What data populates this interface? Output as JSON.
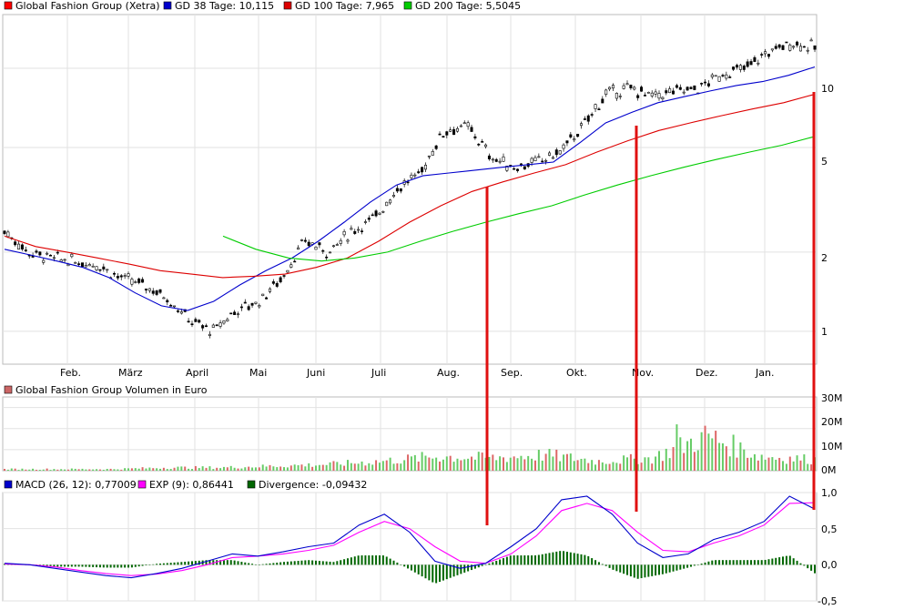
{
  "chart_data": [
    {
      "type": "line",
      "panel": "price",
      "scale": "log",
      "ylim": [
        0.75,
        16
      ],
      "y_ticks": [
        1,
        2,
        5,
        10
      ],
      "x_tick_labels": [
        "Feb.",
        "März",
        "April",
        "Mai",
        "Juni",
        "Juli",
        "Aug.",
        "Sep.",
        "Okt.",
        "Nov.",
        "Dez.",
        "Jan."
      ],
      "grid": true,
      "legend": [
        {
          "label": "Global Fashion Group (Xetra)",
          "color": "#ff0000"
        },
        {
          "label": "GD 38 Tage: 10,115",
          "color": "#0000cc"
        },
        {
          "label": "GD 100 Tage: 7,965",
          "color": "#dd0000"
        },
        {
          "label": "GD 200 Tage: 5,5045",
          "color": "#00cc00"
        }
      ],
      "price_points": [
        {
          "date": "Jan",
          "v": 2.4
        },
        {
          "date": "Jan",
          "v": 2.0
        },
        {
          "date": "Feb",
          "v": 1.9
        },
        {
          "date": "Feb",
          "v": 1.85
        },
        {
          "date": "Mär",
          "v": 1.8
        },
        {
          "date": "Mär",
          "v": 1.6
        },
        {
          "date": "Mär",
          "v": 1.5
        },
        {
          "date": "Mär",
          "v": 1.35
        },
        {
          "date": "Apr",
          "v": 1.1
        },
        {
          "date": "Apr",
          "v": 1.0
        },
        {
          "date": "Apr",
          "v": 1.2
        },
        {
          "date": "Apr",
          "v": 1.3
        },
        {
          "date": "Mai",
          "v": 1.6
        },
        {
          "date": "Mai",
          "v": 2.2
        },
        {
          "date": "Jun",
          "v": 2.0
        },
        {
          "date": "Jun",
          "v": 2.4
        },
        {
          "date": "Jul",
          "v": 2.7
        },
        {
          "date": "Jul",
          "v": 3.5
        },
        {
          "date": "Aug",
          "v": 4.0
        },
        {
          "date": "Aug",
          "v": 5.8
        },
        {
          "date": "Aug",
          "v": 6.0
        },
        {
          "date": "Sep",
          "v": 4.6
        },
        {
          "date": "Sep",
          "v": 4.2
        },
        {
          "date": "Sep",
          "v": 4.4
        },
        {
          "date": "Okt",
          "v": 4.8
        },
        {
          "date": "Okt",
          "v": 6.0
        },
        {
          "date": "Okt",
          "v": 8.0
        },
        {
          "date": "Nov",
          "v": 8.4
        },
        {
          "date": "Nov",
          "v": 7.8
        },
        {
          "date": "Nov",
          "v": 8.2
        },
        {
          "date": "Dez",
          "v": 8.4
        },
        {
          "date": "Dez",
          "v": 9.5
        },
        {
          "date": "Dez",
          "v": 10.0
        },
        {
          "date": "Jan",
          "v": 11.5
        },
        {
          "date": "Jan",
          "v": 12.5
        },
        {
          "date": "Jan",
          "v": 12.0
        }
      ],
      "series": [
        {
          "name": "GD 38 Tage",
          "color": "#0000cc",
          "values": [
            2.05,
            1.95,
            1.85,
            1.75,
            1.6,
            1.4,
            1.25,
            1.2,
            1.3,
            1.5,
            1.7,
            1.9,
            2.2,
            2.6,
            3.1,
            3.6,
            3.9,
            4.0,
            4.1,
            4.2,
            4.3,
            4.4,
            5.2,
            6.2,
            6.8,
            7.4,
            7.8,
            8.2,
            8.6,
            8.9,
            9.4,
            10.115
          ]
        },
        {
          "name": "GD 100 Tage",
          "color": "#dd0000",
          "values": [
            2.3,
            2.1,
            2.0,
            1.9,
            1.8,
            1.7,
            1.65,
            1.6,
            1.62,
            1.65,
            1.75,
            1.9,
            2.2,
            2.6,
            3.0,
            3.4,
            3.7,
            4.0,
            4.3,
            4.8,
            5.3,
            5.8,
            6.2,
            6.6,
            7.0,
            7.4,
            7.965
          ]
        },
        {
          "name": "GD 200 Tage",
          "color": "#00cc00",
          "values": [
            2.3,
            2.05,
            1.9,
            1.85,
            1.9,
            2.0,
            2.2,
            2.4,
            2.6,
            2.8,
            3.0,
            3.3,
            3.6,
            3.9,
            4.2,
            4.5,
            4.8,
            5.1,
            5.5045
          ]
        }
      ]
    },
    {
      "type": "bar",
      "panel": "volume",
      "title": "Global Fashion Group Volumen in Euro",
      "y_ticks": [
        "0M",
        "10M",
        "20M",
        "30M"
      ],
      "ylim": [
        0,
        35
      ],
      "peak_values_M": [
        1,
        1,
        1,
        2,
        2,
        3,
        4,
        6,
        9,
        8,
        10,
        6,
        8,
        22,
        9,
        7
      ]
    },
    {
      "type": "line",
      "panel": "macd",
      "ylim": [
        -0.5,
        1.0
      ],
      "y_ticks": [
        "1,0",
        "0,5",
        "0,0",
        "-0,5"
      ],
      "legend": [
        {
          "label": "MACD (26, 12): 0,77009",
          "color": "#0000cc"
        },
        {
          "label": "EXP (9): 0,86441",
          "color": "#ff00ff"
        },
        {
          "label": "Divergence: -0,09432",
          "color": "#006600"
        }
      ],
      "series": [
        {
          "name": "MACD (26, 12)",
          "color": "#0000cc",
          "values": [
            0.02,
            0.0,
            -0.05,
            -0.1,
            -0.15,
            -0.18,
            -0.12,
            -0.05,
            0.05,
            0.15,
            0.12,
            0.18,
            0.25,
            0.3,
            0.55,
            0.7,
            0.45,
            0.05,
            -0.05,
            0.02,
            0.25,
            0.5,
            0.9,
            0.95,
            0.7,
            0.3,
            0.1,
            0.15,
            0.35,
            0.45,
            0.6,
            0.95,
            0.77
          ]
        },
        {
          "name": "EXP (9)",
          "color": "#ff00ff",
          "values": [
            0.01,
            0.0,
            -0.03,
            -0.08,
            -0.12,
            -0.15,
            -0.13,
            -0.08,
            0.0,
            0.1,
            0.12,
            0.15,
            0.2,
            0.27,
            0.45,
            0.6,
            0.5,
            0.25,
            0.05,
            0.02,
            0.15,
            0.4,
            0.75,
            0.85,
            0.75,
            0.45,
            0.2,
            0.18,
            0.3,
            0.4,
            0.55,
            0.85,
            0.86
          ]
        }
      ]
    }
  ]
}
